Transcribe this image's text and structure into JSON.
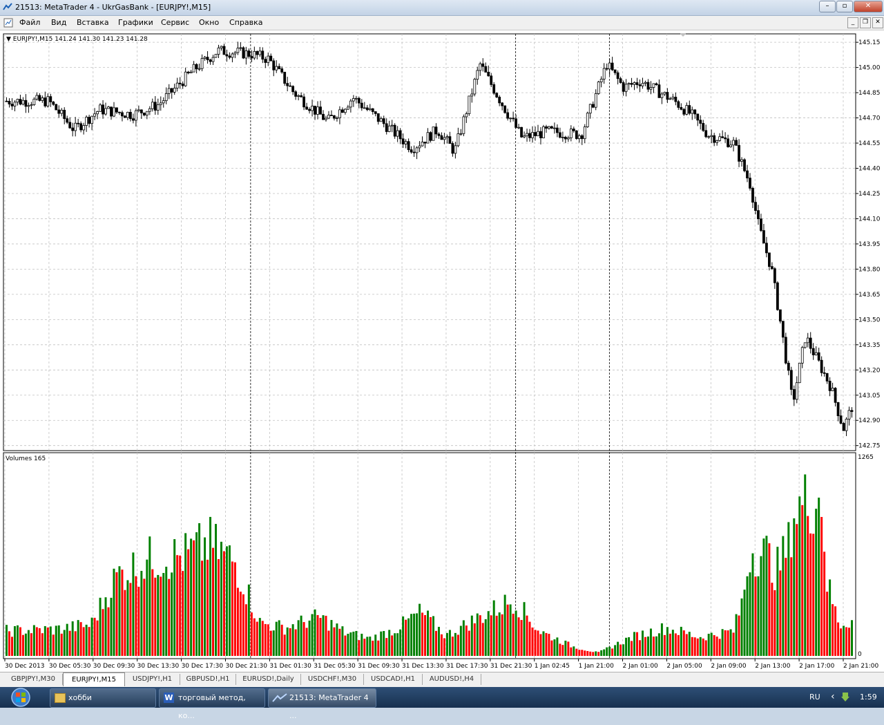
{
  "window": {
    "title": "21513: MetaTrader 4 - UkrGasBank - [EURJPY!,M15]",
    "controls": [
      "–",
      "▫",
      "✕"
    ]
  },
  "menu": {
    "items": [
      "Файл",
      "Вид",
      "Вставка",
      "Графики",
      "Сервис",
      "Окно",
      "Справка"
    ],
    "mdi_controls": [
      "_",
      "❐",
      "✕"
    ]
  },
  "chart": {
    "header": "▼ EURJPY!,M15  141.24 141.30 141.23 141.28",
    "price_ticks": [
      "145.15",
      "145.00",
      "144.85",
      "144.70",
      "144.55",
      "144.40",
      "144.25",
      "144.10",
      "143.95",
      "143.80",
      "143.65",
      "143.50",
      "143.35",
      "143.20",
      "143.05",
      "142.90",
      "142.75"
    ],
    "time_ticks": [
      "30 Dec 2013",
      "30 Dec 05:30",
      "30 Dec 09:30",
      "30 Dec 13:30",
      "30 Dec 17:30",
      "30 Dec 21:30",
      "31 Dec 01:30",
      "31 Dec 05:30",
      "31 Dec 09:30",
      "31 Dec 13:30",
      "31 Dec 17:30",
      "31 Dec 21:30",
      "1 Jan 02:45",
      "1 Jan 21:00",
      "2 Jan 01:00",
      "2 Jan 05:00",
      "2 Jan 09:00",
      "2 Jan 13:00",
      "2 Jan 17:00",
      "2 Jan 21:00"
    ],
    "volume_label": "Volumes 165",
    "volume_ticks": [
      "1265",
      "0"
    ],
    "colors": {
      "bull": "#008000",
      "bear": "#ff0000",
      "candle": "#000000",
      "grid": "#c0c0c0",
      "background": "#ffffff"
    }
  },
  "chart_data": {
    "type": "candlestick+volume",
    "symbol": "EURJPY!",
    "timeframe": "M15",
    "price_range": [
      142.72,
      145.2
    ],
    "volume_range": [
      0,
      1265
    ],
    "day_separators": [
      "31 Dec",
      "1 Jan",
      "2 Jan"
    ],
    "close_path": {
      "x_frac": [
        0.0,
        0.05,
        0.08,
        0.11,
        0.15,
        0.18,
        0.22,
        0.25,
        0.29,
        0.31,
        0.34,
        0.38,
        0.41,
        0.45,
        0.48,
        0.51,
        0.53,
        0.56,
        0.59,
        0.61,
        0.64,
        0.68,
        0.71,
        0.73,
        0.75,
        0.79,
        0.81,
        0.83,
        0.86,
        0.88,
        0.89,
        0.905,
        0.915,
        0.93,
        0.945,
        0.96,
        0.975,
        0.99,
        1.0
      ],
      "price": [
        144.8,
        144.8,
        144.63,
        144.75,
        144.72,
        144.78,
        144.98,
        145.1,
        145.08,
        145.05,
        144.85,
        144.68,
        144.82,
        144.65,
        144.52,
        144.63,
        144.5,
        145.02,
        144.75,
        144.58,
        144.62,
        144.6,
        145.02,
        144.88,
        144.92,
        144.8,
        144.72,
        144.6,
        144.55,
        144.3,
        144.05,
        143.8,
        143.5,
        143.0,
        143.4,
        143.25,
        143.1,
        142.85,
        142.98
      ]
    },
    "volume_path": {
      "x_frac": [
        0.0,
        0.06,
        0.1,
        0.13,
        0.17,
        0.21,
        0.24,
        0.27,
        0.3,
        0.33,
        0.37,
        0.4,
        0.43,
        0.46,
        0.49,
        0.52,
        0.55,
        0.6,
        0.63,
        0.67,
        0.7,
        0.74,
        0.78,
        0.82,
        0.86,
        0.87,
        0.88,
        0.9,
        0.91,
        0.925,
        0.93,
        0.95,
        0.965,
        0.97,
        0.985,
        1.0
      ],
      "volume": [
        160,
        170,
        200,
        510,
        620,
        640,
        720,
        600,
        210,
        180,
        250,
        150,
        110,
        170,
        280,
        130,
        220,
        360,
        160,
        60,
        20,
        120,
        180,
        120,
        160,
        340,
        680,
        650,
        540,
        700,
        910,
        1000,
        1010,
        480,
        200,
        230
      ]
    }
  },
  "tabs": {
    "items": [
      "GBPJPY!,M30",
      "EURJPY!,M15",
      "USDJPY!,H1",
      "GBPUSD!,H1",
      "EURUSD!,Daily",
      "USDCHF!,M30",
      "USDCAD!,H1",
      "AUDUSD!,H4"
    ],
    "active": "EURJPY!,M15"
  },
  "taskbar": {
    "buttons": [
      {
        "label": "хобби",
        "icon": "folder-icon"
      },
      {
        "label": "торговый метод, ко...",
        "icon": "word-icon"
      },
      {
        "label": "21513: MetaTrader 4 ...",
        "icon": "metatrader-icon"
      }
    ],
    "language": "RU",
    "clock": "1:59"
  }
}
